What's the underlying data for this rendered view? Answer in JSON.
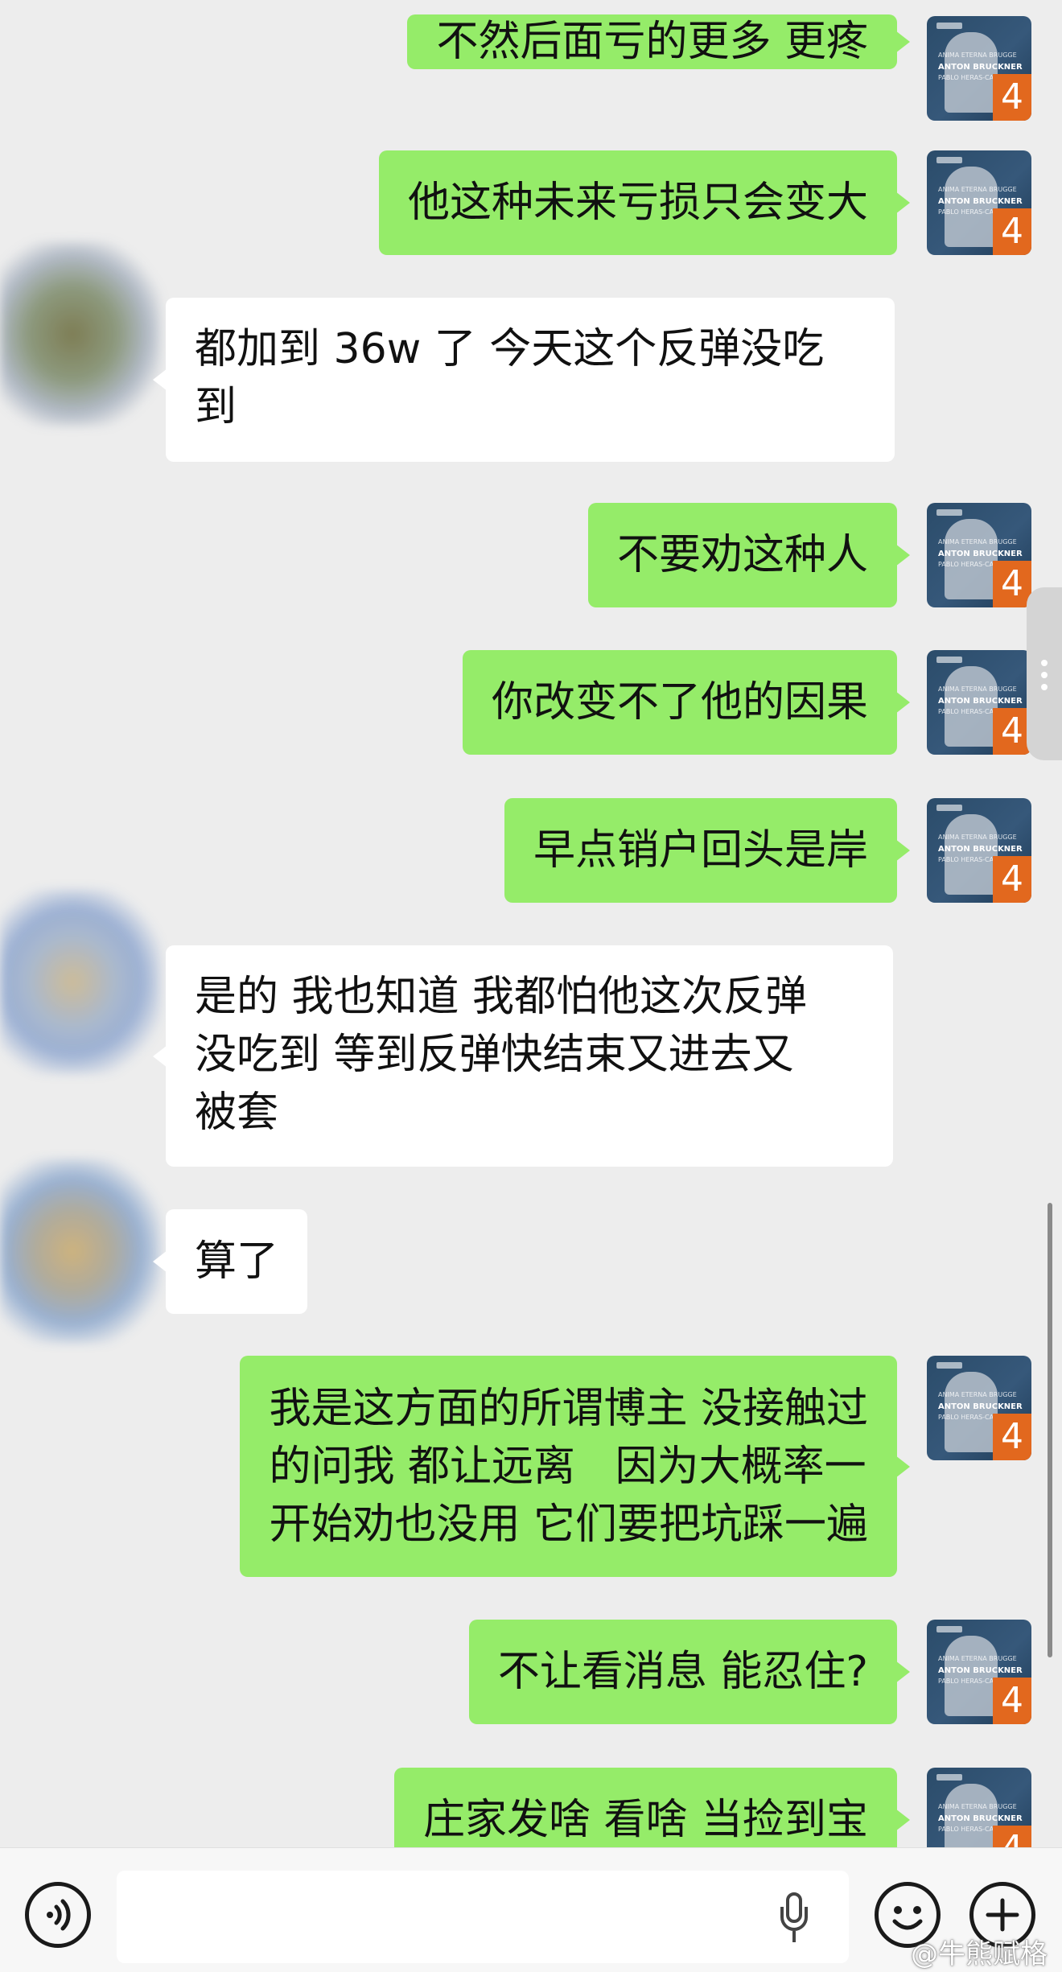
{
  "messages": [
    {
      "sender": "me",
      "lines": [
        "不然后面亏的更多 更疼"
      ]
    },
    {
      "sender": "me",
      "lines": [
        "他这种未来亏损只会变大"
      ]
    },
    {
      "sender": "contact",
      "lines": [
        "都加到 36w 了 今天这个反弹没吃",
        "到"
      ]
    },
    {
      "sender": "me",
      "lines": [
        "不要劝这种人"
      ]
    },
    {
      "sender": "me",
      "lines": [
        "你改变不了他的因果"
      ]
    },
    {
      "sender": "me",
      "lines": [
        "早点销户回头是岸"
      ]
    },
    {
      "sender": "contact",
      "lines": [
        "是的 我也知道 我都怕他这次反弹",
        "没吃到 等到反弹快结束又进去又",
        "被套"
      ]
    },
    {
      "sender": "contact",
      "lines": [
        "算了"
      ]
    },
    {
      "sender": "me",
      "lines": [
        "我是这方面的所谓博主 没接触过",
        "的问我 都让远离   因为大概率一",
        "开始劝也没用 它们要把坑踩一遍"
      ]
    },
    {
      "sender": "me",
      "lines": [
        "不让看消息 能忍住?"
      ]
    },
    {
      "sender": "me",
      "lines": [
        "庄家发啥 看啥 当捡到宝"
      ]
    }
  ],
  "my_avatar": {
    "line1": "ANIMA ETERNA BRUGGE",
    "line2": "ANTON BRUCKNER",
    "line3": "PABLO HERAS-CASADO",
    "number": "4"
  },
  "bottom_bar": {
    "input_value": "",
    "watermark": "@牛熊赋格"
  },
  "colors": {
    "background": "#ededed",
    "my_bubble": "#95ec69",
    "contact_bubble": "#ffffff",
    "avatar_accent": "#e2681e"
  },
  "icons": [
    "voice-mode-icon",
    "microphone-icon",
    "emoji-icon",
    "plus-icon",
    "more-dots-icon"
  ]
}
